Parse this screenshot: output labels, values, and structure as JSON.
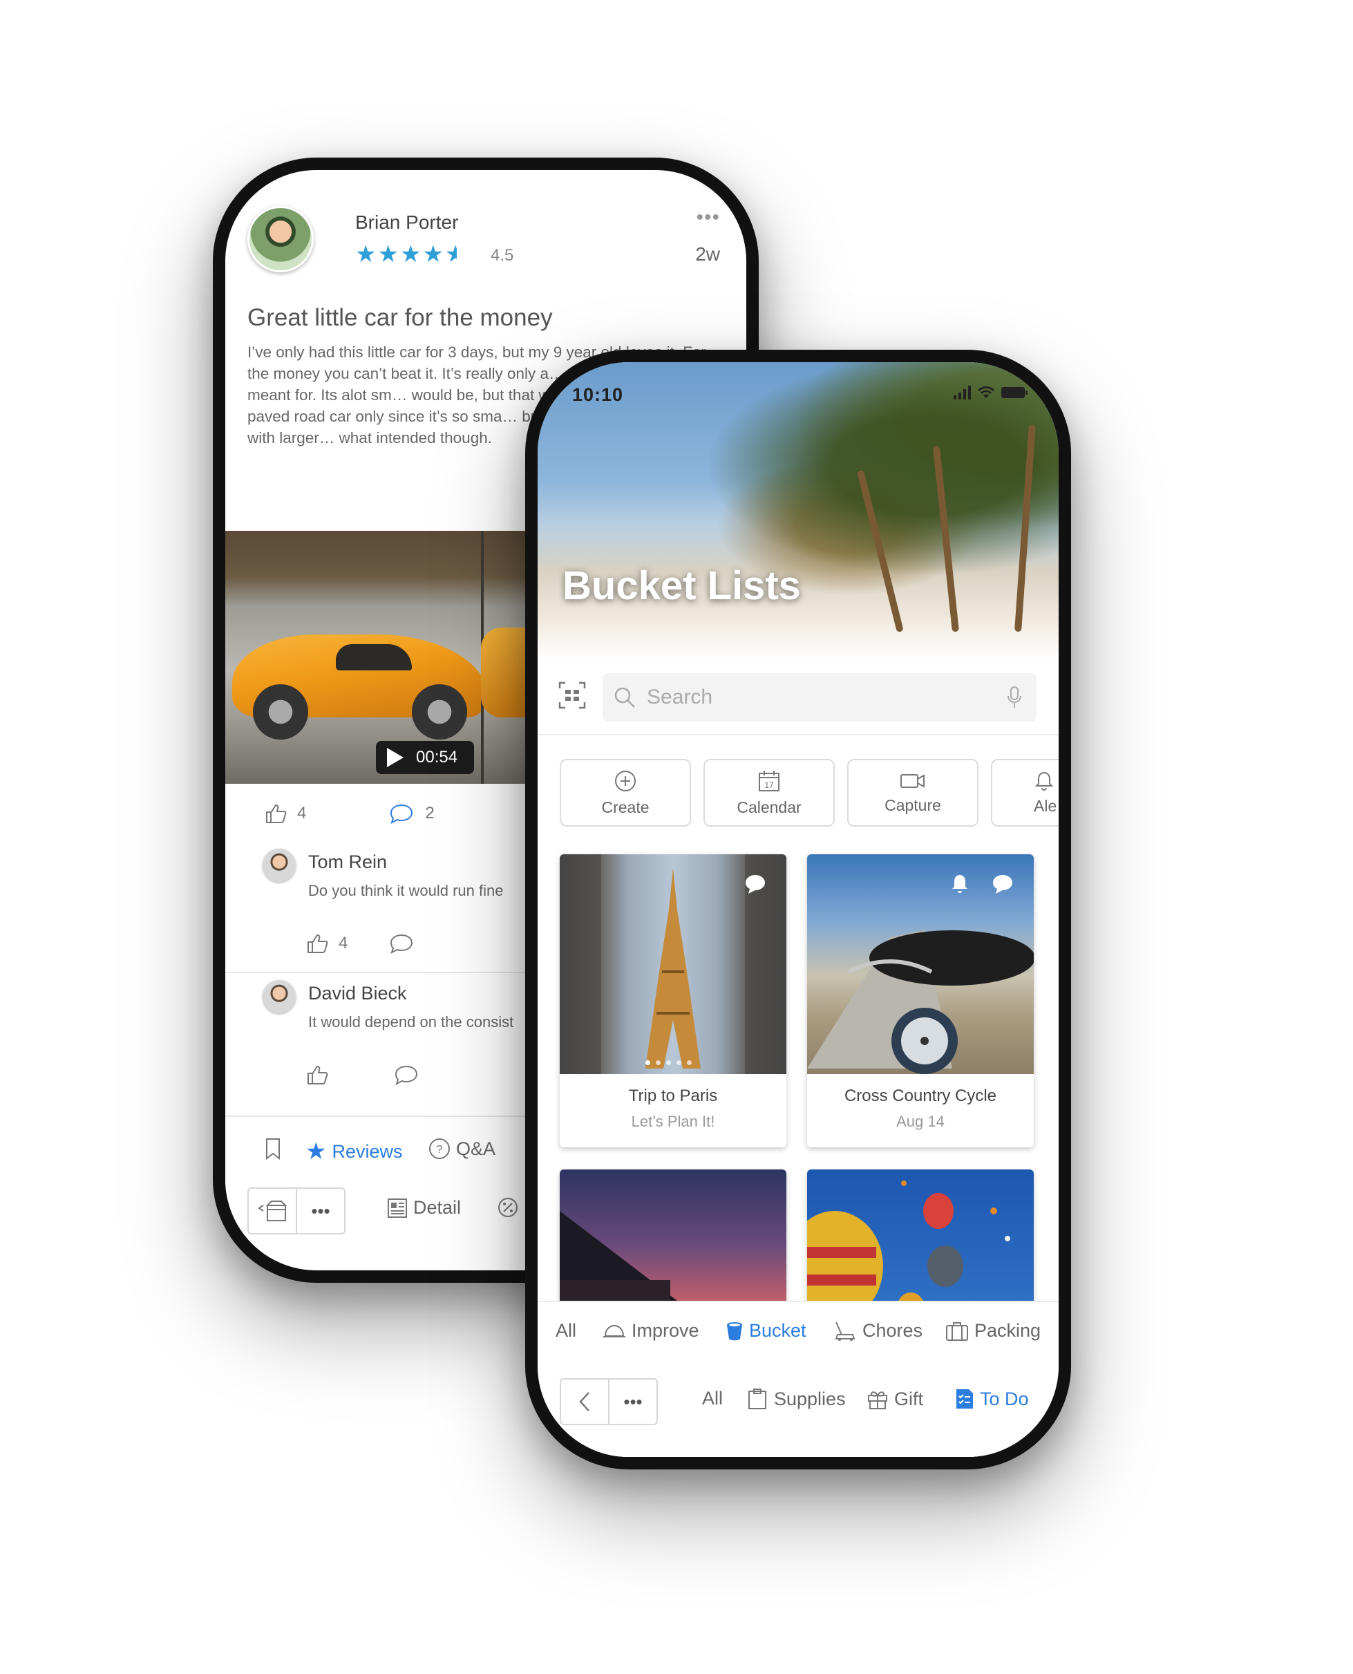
{
  "review": {
    "reviewer_name": "Brian Porter",
    "rating": "4.5",
    "stars": "★★★★",
    "age": "2w",
    "more": "•••",
    "title": "Great little car for the money",
    "body": "I’ve only had this little car for 3 days, but my 9 year old loves it. For the money you can’t beat it.  It’s really only a… think that’s who its meant for. Its alot sm… would be, but that works fine for my kid… flat paved road car only since it’s so sma… bumpy tracks, or even roads with larger… what intended though.",
    "video_duration": "00:54",
    "likes": "4",
    "comments": "2",
    "comments_list": [
      {
        "name": "Tom Rein",
        "text": "Do you think it would run fine",
        "likes": "4"
      },
      {
        "name": "David Bieck",
        "text": "It would depend on the consist",
        "likes": ""
      }
    ]
  },
  "back_tabs": {
    "reviews": "Reviews",
    "qa": "Q&A",
    "detail": "Detail",
    "more": "•••"
  },
  "front": {
    "time": "10:10",
    "hero_title": "Bucket Lists",
    "search_placeholder": "Search",
    "quick_actions": [
      {
        "label": "Create",
        "icon": "plus-circle-icon"
      },
      {
        "label": "Calendar",
        "icon": "calendar-icon",
        "day": "17"
      },
      {
        "label": "Capture",
        "icon": "video-camera-icon"
      },
      {
        "label": "Ale",
        "icon": "bell-icon"
      }
    ],
    "cards": [
      {
        "title": "Trip to Paris",
        "subtitle": "Let’s Plan It!"
      },
      {
        "title": "Cross Country Cycle",
        "subtitle": "Aug 14"
      }
    ],
    "tabs_row1": {
      "all": "All",
      "improve": "Improve",
      "bucket": "Bucket",
      "chores": "Chores",
      "packing": "Packing"
    },
    "tabs_row2": {
      "more": "•••",
      "all": "All",
      "supplies": "Supplies",
      "gift": "Gift",
      "todo": "To Do"
    }
  },
  "colors": {
    "accent_blue": "#2b7de0",
    "star_blue": "#2f9fd8"
  }
}
